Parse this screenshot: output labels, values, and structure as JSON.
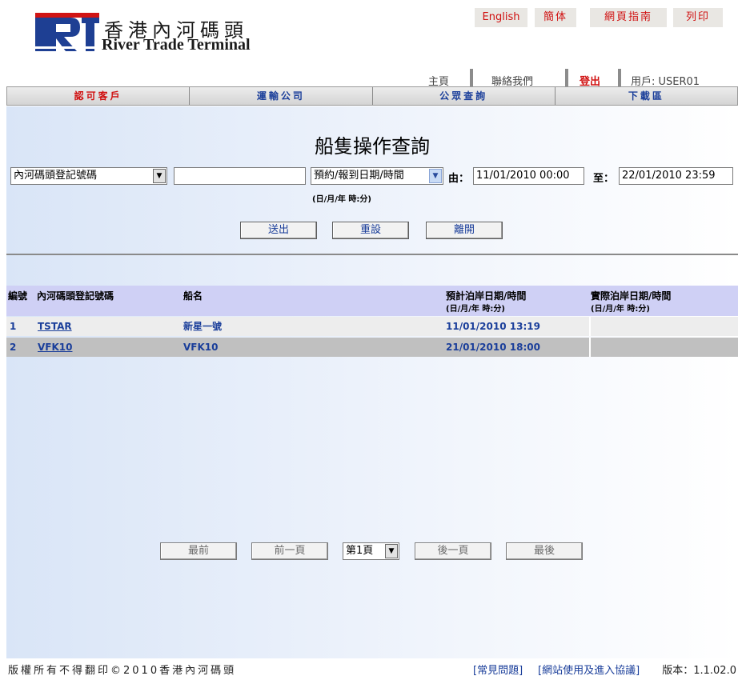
{
  "brand": {
    "name_zh": "香港內河碼頭",
    "name_en": "River Trade Terminal"
  },
  "top_buttons": {
    "english": "English",
    "simplified": "簡体",
    "guide": "網頁指南",
    "print": "列印"
  },
  "user_nav": {
    "home": "主頁",
    "contact": "聯絡我們",
    "logout": "登出",
    "user": "用戶: USER01"
  },
  "nav": [
    "認可客戶",
    "運輸公司",
    "公眾查詢",
    "下載區"
  ],
  "page_title": "船隻操作查詢",
  "search": {
    "field_select": "內河碼頭登記號碼",
    "keyword_value": "",
    "date_type_select": "預約/報到日期/時間",
    "from_label": "由：",
    "from_value": "11/01/2010 00:00",
    "to_label": "至：",
    "to_value": "22/01/2010 23:59",
    "format_hint": "(日/月/年 時:分)"
  },
  "actions": {
    "submit": "送出",
    "reset": "重設",
    "leave": "離開"
  },
  "table": {
    "headers": {
      "no": "編號",
      "reg_no": "內河碼頭登記號碼",
      "vessel": "船名",
      "eta": "預計泊岸日期/時間",
      "eta_fmt": "(日/月/年  時:分)",
      "ata": "實際泊岸日期/時間",
      "ata_fmt": "(日/月/年  時:分)"
    },
    "rows": [
      {
        "no": "1",
        "reg_no": "TSTAR",
        "vessel": "新星一號",
        "eta": "11/01/2010 13:19",
        "ata": ""
      },
      {
        "no": "2",
        "reg_no": "VFK10",
        "vessel": "VFK10",
        "eta": "21/01/2010 18:00",
        "ata": ""
      }
    ]
  },
  "pager": {
    "first": "最前",
    "prev": "前一頁",
    "page": "第1頁",
    "next": "後一頁",
    "last": "最後"
  },
  "footer": {
    "copyright": "版權所有不得翻印©2010香港內河碼頭",
    "faq": "[常見問題]",
    "terms": "[網站使用及進入協議]",
    "version": "版本：1.1.02.0"
  }
}
